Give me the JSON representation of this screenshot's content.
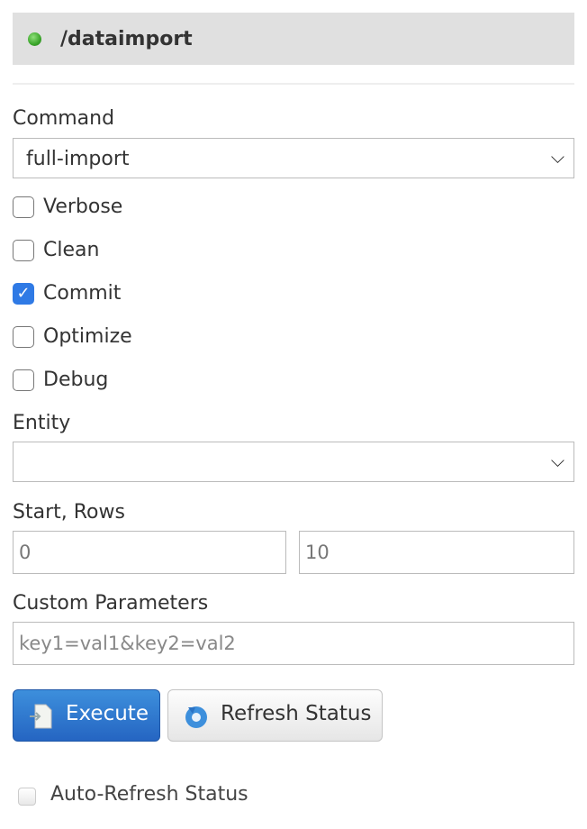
{
  "header": {
    "title": "/dataimport",
    "status_color": "#3aa52a"
  },
  "command": {
    "label": "Command",
    "value": "full-import"
  },
  "options": [
    {
      "label": "Verbose",
      "checked": false
    },
    {
      "label": "Clean",
      "checked": false
    },
    {
      "label": "Commit",
      "checked": true
    },
    {
      "label": "Optimize",
      "checked": false
    },
    {
      "label": "Debug",
      "checked": false
    }
  ],
  "entity": {
    "label": "Entity",
    "value": ""
  },
  "start_rows": {
    "label": "Start, Rows",
    "start": "0",
    "rows": "10"
  },
  "custom": {
    "label": "Custom Parameters",
    "placeholder": "key1=val1&key2=val2"
  },
  "buttons": {
    "execute": "Execute",
    "refresh": "Refresh Status"
  },
  "auto_refresh": {
    "label": "Auto-Refresh Status",
    "checked": false
  }
}
